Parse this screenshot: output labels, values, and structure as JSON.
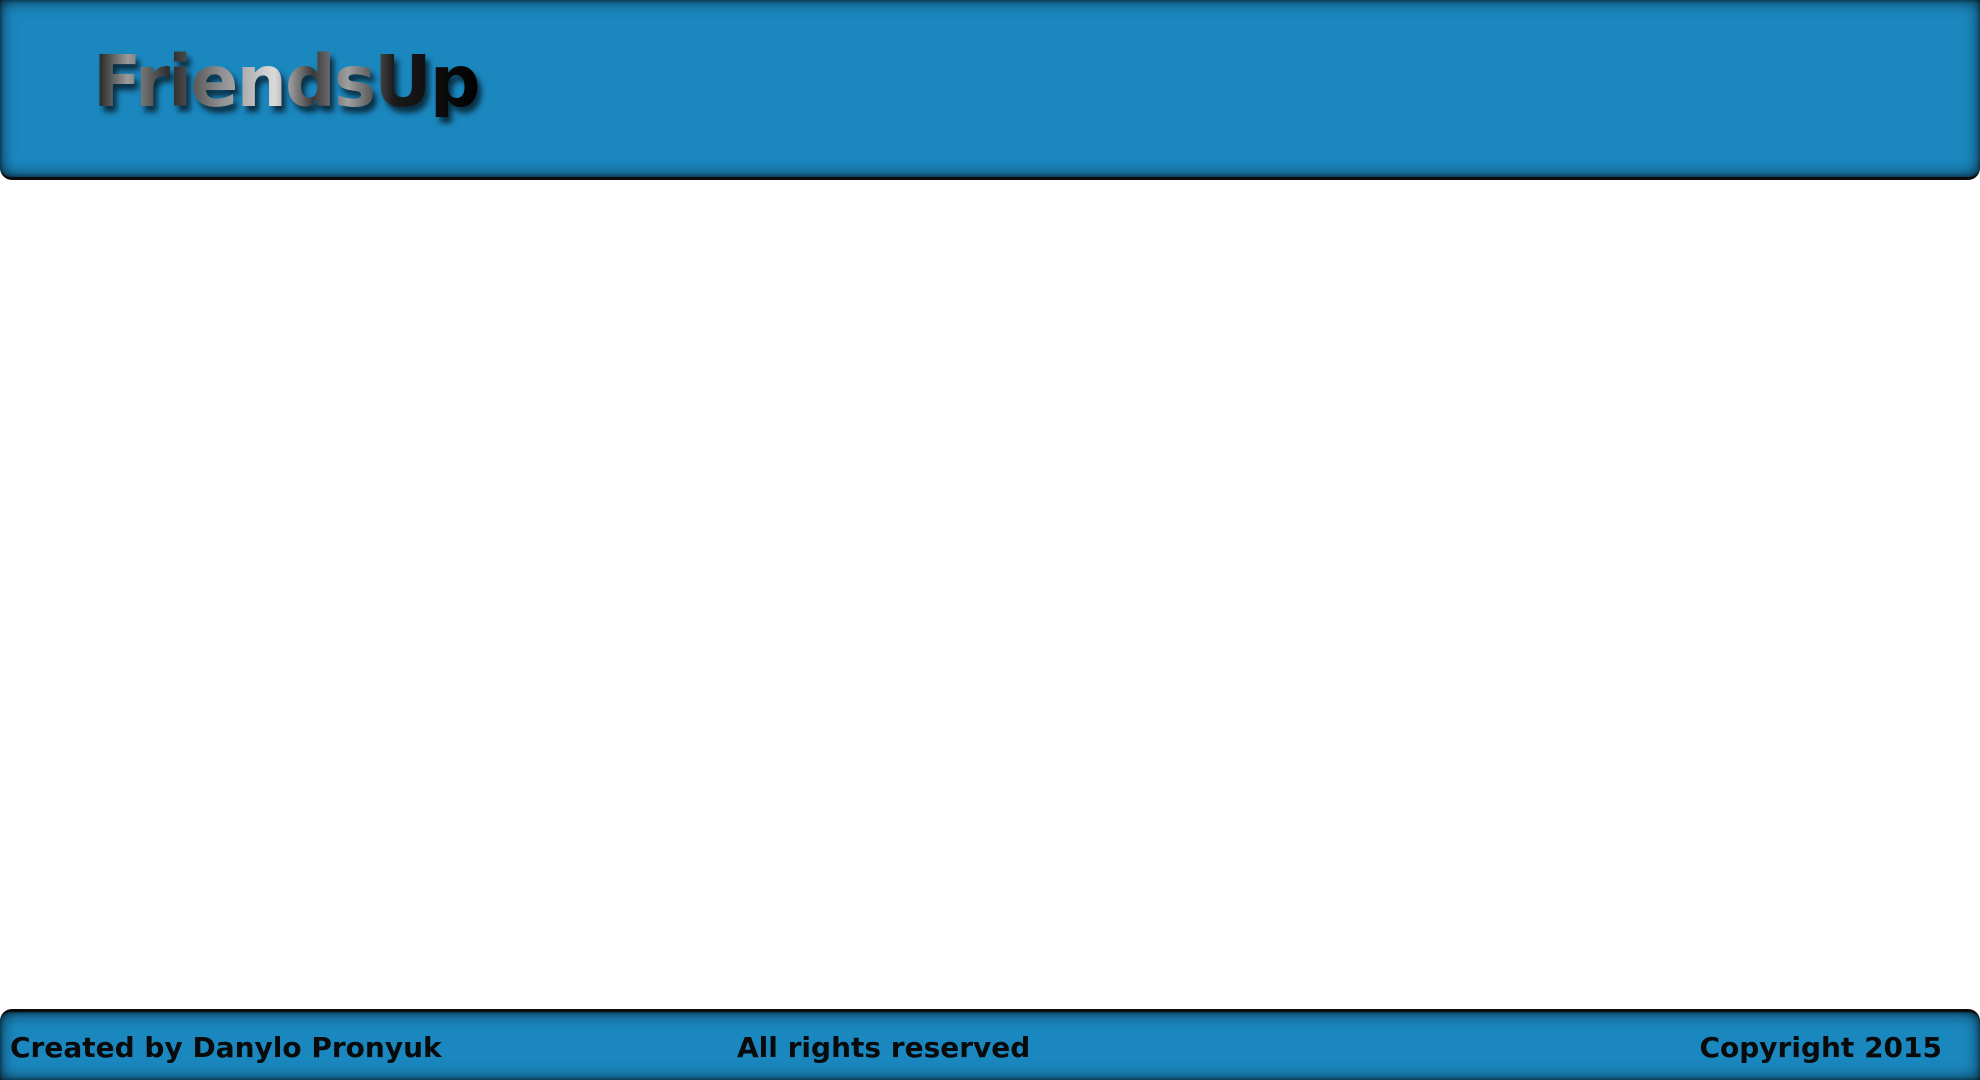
{
  "header": {
    "logo_text": "FriendsUp"
  },
  "footer": {
    "created_by": "Created by Danylo Pronyuk",
    "rights": "All rights reserved",
    "copyright": "Copyright 2015"
  },
  "colors": {
    "bar_background": "#1b87bf",
    "bar_border": "#0b0b0b",
    "page_background": "#ffffff",
    "footer_text": "#0a0a0a"
  }
}
